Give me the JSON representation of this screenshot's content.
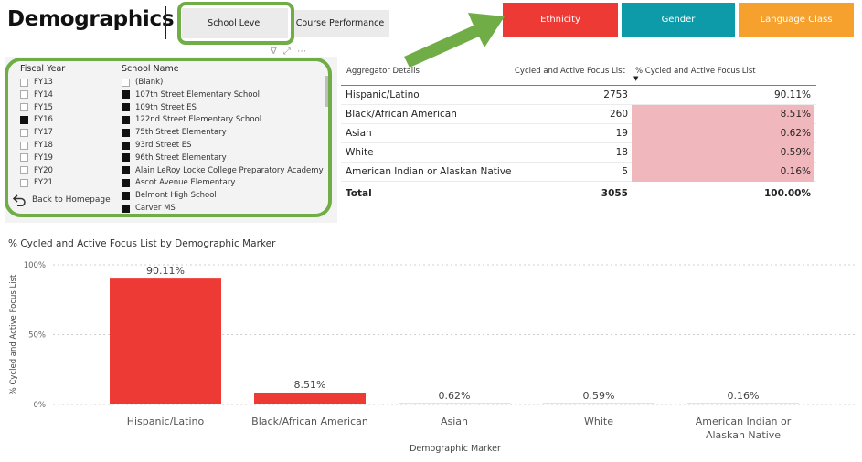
{
  "header": {
    "title": "Demographics",
    "tabs": [
      "School Level",
      "Course Performance"
    ],
    "nav": [
      {
        "label": "Ethnicity",
        "color": "#ee3a35"
      },
      {
        "label": "Gender",
        "color": "#0e9ba9"
      },
      {
        "label": "Language Class",
        "color": "#f6a02d"
      }
    ],
    "highlight_color": "#70ad47"
  },
  "slicer": {
    "fiscal_year": {
      "heading": "Fiscal Year",
      "items": [
        {
          "label": "FY13",
          "checked": false
        },
        {
          "label": "FY14",
          "checked": false
        },
        {
          "label": "FY15",
          "checked": false
        },
        {
          "label": "FY16",
          "checked": true
        },
        {
          "label": "FY17",
          "checked": false
        },
        {
          "label": "FY18",
          "checked": false
        },
        {
          "label": "FY19",
          "checked": false
        },
        {
          "label": "FY20",
          "checked": false
        },
        {
          "label": "FY21",
          "checked": false
        }
      ]
    },
    "school_name": {
      "heading": "School Name",
      "items": [
        {
          "label": "(Blank)",
          "checked": false
        },
        {
          "label": "107th Street Elementary School",
          "checked": true
        },
        {
          "label": "109th Street ES",
          "checked": true
        },
        {
          "label": "122nd Street Elementary School",
          "checked": true
        },
        {
          "label": "75th Street Elementary",
          "checked": true
        },
        {
          "label": "93rd Street ES",
          "checked": true
        },
        {
          "label": "96th Street Elementary",
          "checked": true
        },
        {
          "label": "Alain LeRoy Locke College Preparatory Academy",
          "checked": true
        },
        {
          "label": "Ascot Avenue Elementary",
          "checked": true
        },
        {
          "label": "Belmont High School",
          "checked": true
        },
        {
          "label": "Carver MS",
          "checked": true
        }
      ]
    },
    "back_label": "Back to Homepage"
  },
  "table": {
    "headers": [
      "Aggregator Details",
      "Cycled and Active Focus List",
      "% Cycled and Active Focus List"
    ],
    "rows": [
      {
        "name": "Hispanic/Latino",
        "count": "2753",
        "pct": "90.11%",
        "highlight": false
      },
      {
        "name": "Black/African American",
        "count": "260",
        "pct": "8.51%",
        "highlight": true
      },
      {
        "name": "Asian",
        "count": "19",
        "pct": "0.62%",
        "highlight": true
      },
      {
        "name": "White",
        "count": "18",
        "pct": "0.59%",
        "highlight": true
      },
      {
        "name": "American Indian or Alaskan Native",
        "count": "5",
        "pct": "0.16%",
        "highlight": true
      }
    ],
    "total": {
      "name": "Total",
      "count": "3055",
      "pct": "100.00%"
    },
    "highlight_color": "#f0b8bc"
  },
  "chart_data": {
    "type": "bar",
    "title": "% Cycled and Active Focus List by Demographic Marker",
    "xlabel": "Demographic Marker",
    "ylabel": "% Cycled and Active Focus List",
    "categories": [
      "Hispanic/Latino",
      "Black/African American",
      "Asian",
      "White",
      "American Indian or Alaskan Native"
    ],
    "values": [
      90.11,
      8.51,
      0.62,
      0.59,
      0.16
    ],
    "data_labels": [
      "90.11%",
      "8.51%",
      "0.62%",
      "0.59%",
      "0.16%"
    ],
    "y_ticks": [
      "0%",
      "50%",
      "100%"
    ],
    "ylim": [
      0,
      100
    ],
    "grid": true,
    "bar_color": "#ee3a35"
  }
}
